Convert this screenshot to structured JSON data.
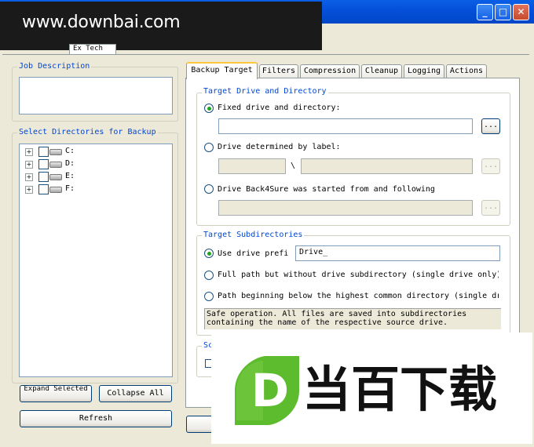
{
  "watermark_text": "www.downbai.com",
  "window_buttons": [
    "minimize",
    "maximize",
    "close"
  ],
  "top_tabs": [
    "",
    "Ex Tech"
  ],
  "job_description": {
    "label": "Job Description",
    "value": ""
  },
  "directories": {
    "label": "Select Directories for Backup",
    "drives": [
      {
        "name": "C:"
      },
      {
        "name": "D:"
      },
      {
        "name": "E:"
      },
      {
        "name": "F:"
      }
    ]
  },
  "buttons": {
    "expand_selected": "Expand Selected",
    "collapse_all": "Collapse All",
    "refresh": "Refresh",
    "browse": "..."
  },
  "tabs": [
    "Backup Target",
    "Filters",
    "Compression",
    "Cleanup",
    "Logging",
    "Actions"
  ],
  "target_drive": {
    "label": "Target Drive and Directory",
    "fixed": "Fixed drive and directory:",
    "by_label": "Drive determined by label:",
    "separator": "\\",
    "started_from": "Drive Back4Sure was started from and following"
  },
  "target_subdirs": {
    "label": "Target Subdirectories",
    "use_prefix": "Use drive prefi",
    "prefix_value": "Drive_",
    "full_path": "Full path but without drive subdirectory (single drive only)",
    "common_path": "Path beginning below the highest common directory (single dr",
    "description": "Safe operation. All files are saved into subdirectories containing the name of the respective source drive."
  },
  "partial_group_label": "Sc",
  "logo_text": "当百下载",
  "logo_letter": "D",
  "colors": {
    "group_label": "#0046D5",
    "logo_green": "#5DBB2E",
    "titlebar": "#0551D9"
  }
}
